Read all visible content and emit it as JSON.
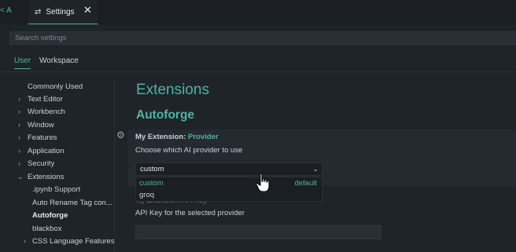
{
  "tabs": {
    "prev_tab_label": "< A",
    "settings_label": "Settings",
    "close_glyph": "✕"
  },
  "search": {
    "placeholder": "Search settings"
  },
  "scopes": {
    "user": "User",
    "workspace": "Workspace"
  },
  "toc": {
    "items": [
      {
        "label": "Commonly Used",
        "expandable": false
      },
      {
        "label": "Text Editor",
        "expandable": true
      },
      {
        "label": "Workbench",
        "expandable": true
      },
      {
        "label": "Window",
        "expandable": true
      },
      {
        "label": "Features",
        "expandable": true
      },
      {
        "label": "Application",
        "expandable": true
      },
      {
        "label": "Security",
        "expandable": true
      },
      {
        "label": "Extensions",
        "expandable": true,
        "expanded": true
      },
      {
        "label": ".ipynb Support",
        "expandable": false
      },
      {
        "label": "Auto Rename Tag con...",
        "expandable": false
      },
      {
        "label": "Autoforge",
        "expandable": false,
        "active": true
      },
      {
        "label": "blackbox",
        "expandable": false
      },
      {
        "label": "CSS Language Features",
        "expandable": true
      }
    ]
  },
  "main": {
    "section_title": "Extensions",
    "group_title": "Autoforge",
    "provider_setting": {
      "prefix": "My Extension: ",
      "key": "Provider",
      "description": "Choose which AI provider to use",
      "value": "custom",
      "options": [
        {
          "label": "custom",
          "tag": "default"
        },
        {
          "label": "groq"
        }
      ]
    },
    "api_key_setting": {
      "description": "API Key for the selected provider",
      "value": ""
    }
  },
  "colors": {
    "accent": "#4fb3a5",
    "background": "#1f2428",
    "text": "#c9d1d9"
  }
}
